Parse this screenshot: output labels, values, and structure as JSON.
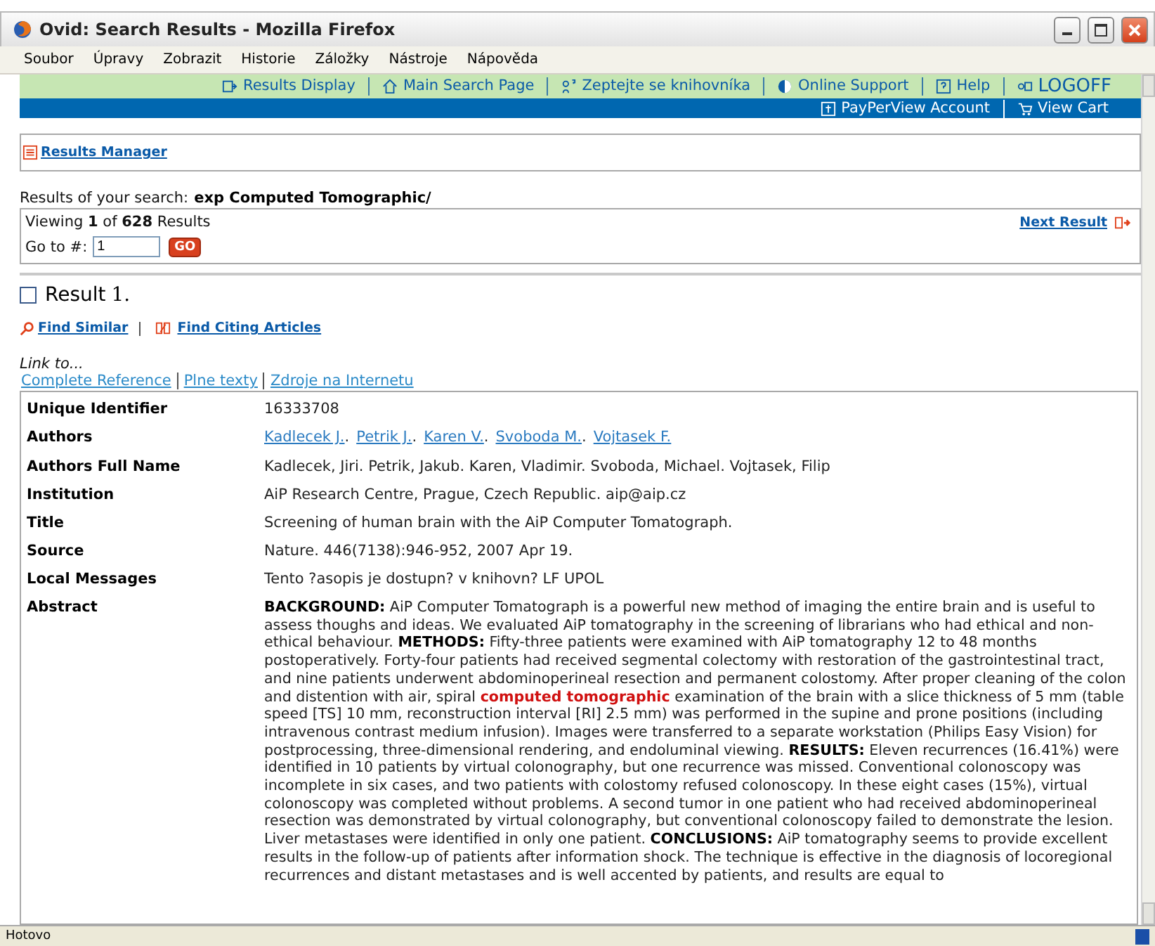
{
  "window": {
    "title": "Ovid: Search Results - Mozilla Firefox"
  },
  "menu": [
    "Soubor",
    "Úpravy",
    "Zobrazit",
    "Historie",
    "Záložky",
    "Nástroje",
    "Nápověda"
  ],
  "nav_links": [
    {
      "label": "Results Display",
      "kind": "display"
    },
    {
      "label": "Main Search Page",
      "kind": "home"
    },
    {
      "label": "Zeptejte se knihovníka",
      "kind": "ask"
    },
    {
      "label": "Online Support",
      "kind": "support"
    },
    {
      "label": "Help",
      "kind": "help"
    },
    {
      "label": "LOGOFF",
      "kind": "logoff"
    }
  ],
  "account_links": [
    {
      "label": "PayPerView Account",
      "kind": "account"
    },
    {
      "label": "View Cart",
      "kind": "cart"
    }
  ],
  "results_manager": "Results Manager",
  "search": {
    "prefix": "Results of your search:",
    "query": "exp Computed Tomographic/"
  },
  "viewing": "Viewing **1** of **628** Results",
  "next_result": "Next Result",
  "goto": {
    "label": "Go to #:",
    "value": "1",
    "button": "GO"
  },
  "result": {
    "checked": false,
    "label": "Result",
    "number": "1."
  },
  "actions": [
    {
      "label": "Find Similar",
      "kind": "similar"
    },
    {
      "label": "Find Citing Articles",
      "kind": "citing"
    }
  ],
  "link_to": {
    "label": "Link to...",
    "links": [
      "Complete Reference",
      "Plne texty",
      "Zdroje na Internetu"
    ]
  },
  "record": [
    {
      "label": "Unique Identifier",
      "kind": "text",
      "value": "16333708"
    },
    {
      "label": "Authors",
      "kind": "links",
      "separator": ".",
      "links": [
        "Kadlecek J.",
        "Petrik J.",
        "Karen V.",
        "Svoboda M.",
        "Vojtasek F."
      ]
    },
    {
      "label": "Authors Full Name",
      "kind": "text",
      "value": "Kadlecek, Jiri. Petrik, Jakub. Karen, Vladimir. Svoboda, Michael. Vojtasek, Filip"
    },
    {
      "label": "Institution",
      "kind": "text",
      "value": "AiP Research Centre, Prague, Czech Republic. aip@aip.cz"
    },
    {
      "label": "Title",
      "kind": "text",
      "value": "Screening of human brain with the AiP Computer Tomatograph."
    },
    {
      "label": "Source",
      "kind": "text",
      "value": "Nature. 446(7138):946-952, 2007 Apr 19."
    },
    {
      "label": "Local Messages",
      "kind": "text",
      "value": "Tento ?asopis je dostupn? v knihovn? LF UPOL"
    },
    {
      "label": "Abstract",
      "kind": "abstract",
      "segments": [
        {
          "kind": "heading",
          "text": "BACKGROUND:"
        },
        {
          "kind": "plain",
          "text": " AiP Computer Tomatograph is a powerful new method of imaging the entire brain and is useful to assess thoughs and ideas. We evaluated AiP tomatography in the screening of librarians who had ethical and non-ethical behaviour. "
        },
        {
          "kind": "heading",
          "text": "METHODS:"
        },
        {
          "kind": "plain",
          "text": " Fifty-three patients were examined with AiP tomatography 12 to 48 months postoperatively. Forty-four patients had received segmental colectomy with restoration of the gastrointestinal tract, and nine patients underwent abdominoperineal resection and permanent colostomy. After proper cleaning of the colon and distention with air, spiral "
        },
        {
          "kind": "highlight",
          "text": "computed tomographic"
        },
        {
          "kind": "plain",
          "text": " examination of the brain with a slice thickness of 5 mm (table speed [TS] 10 mm, reconstruction interval [RI] 2.5 mm) was performed in the supine and prone positions (including intravenous contrast medium infusion). Images were transferred to a separate workstation (Philips Easy Vision) for postprocessing, three-dimensional rendering, and endoluminal viewing. "
        },
        {
          "kind": "heading",
          "text": "RESULTS:"
        },
        {
          "kind": "plain",
          "text": " Eleven recurrences (16.41%) were identified in 10 patients by virtual colonography, but one recurrence was missed. Conventional colonoscopy was incomplete in six cases, and two patients with colostomy refused colonoscopy. In these eight cases (15%), virtual colonoscopy was completed without problems. A second tumor in one patient who had received abdominoperineal resection was demonstrated by virtual colonography, but conventional colonoscopy failed to demonstrate the lesion. Liver metastases were identified in only one patient. "
        },
        {
          "kind": "heading",
          "text": "CONCLUSIONS:"
        },
        {
          "kind": "plain",
          "text": " AiP tomatography seems to provide excellent results in the follow-up of patients after information shock. The technique is effective in the diagnosis of locoregional recurrences and distant metastases and is well accented by patients, and results are equal to"
        }
      ]
    }
  ],
  "status_bar": "Hotovo"
}
